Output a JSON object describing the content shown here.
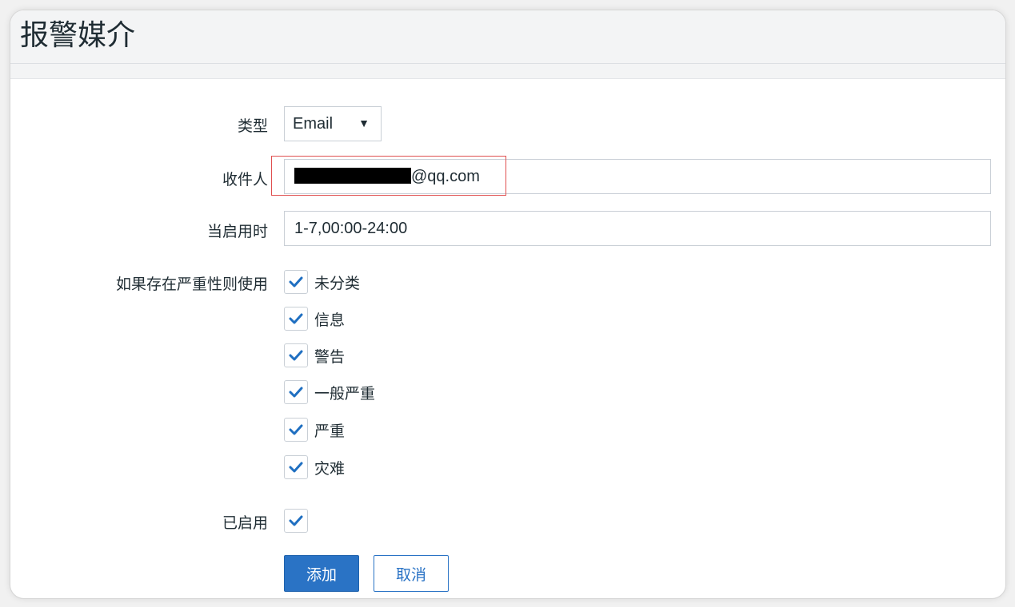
{
  "dialog": {
    "title": "报警媒介"
  },
  "form": {
    "type": {
      "label": "类型",
      "value": "Email",
      "caret_icon": "▼"
    },
    "recipient": {
      "label": "收件人",
      "value_suffix": "@qq.com",
      "redacted": true,
      "highlight_color": "#e05050"
    },
    "active_time": {
      "label": "当启用时",
      "value": "1-7,00:00-24:00"
    },
    "severity": {
      "label": "如果存在严重性则使用",
      "options": [
        {
          "label": "未分类",
          "checked": true
        },
        {
          "label": "信息",
          "checked": true
        },
        {
          "label": "警告",
          "checked": true
        },
        {
          "label": "一般严重",
          "checked": true
        },
        {
          "label": "严重",
          "checked": true
        },
        {
          "label": "灾难",
          "checked": true
        }
      ]
    },
    "enabled": {
      "label": "已启用",
      "checked": true
    }
  },
  "buttons": {
    "add_label": "添加",
    "cancel_label": "取消"
  },
  "colors": {
    "accent": "#2a73c5",
    "check": "#1f6fc1",
    "text": "#1f2c33"
  }
}
